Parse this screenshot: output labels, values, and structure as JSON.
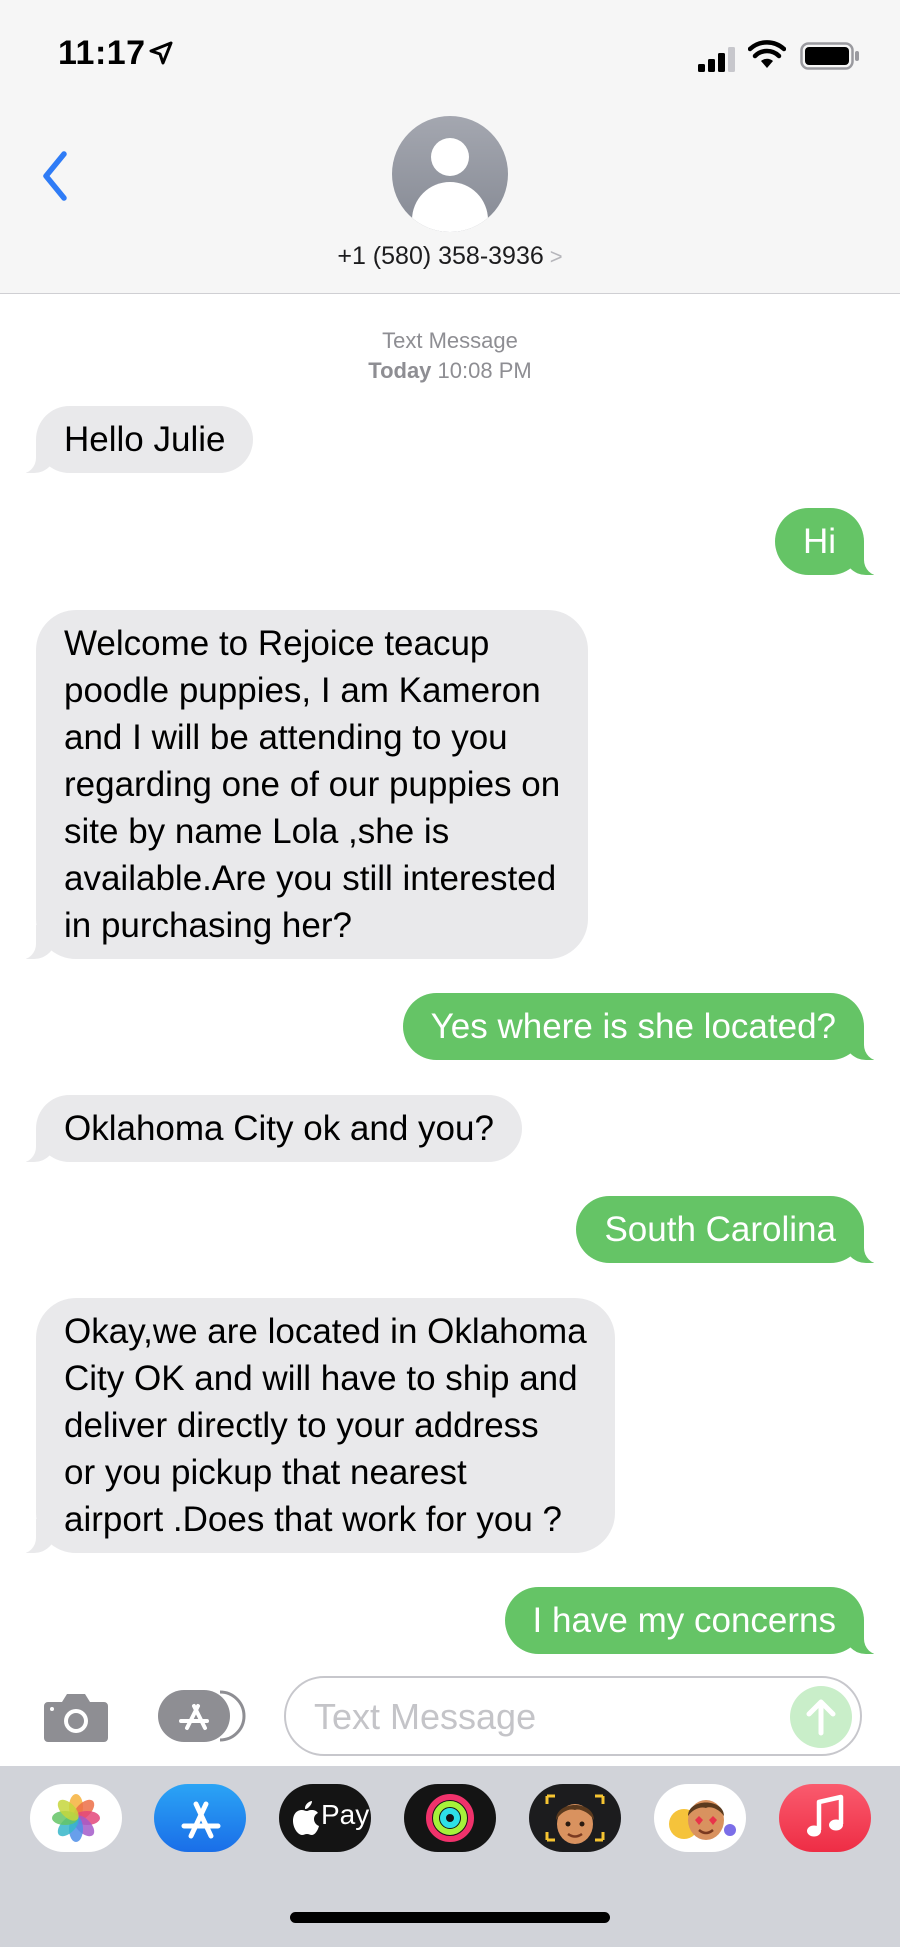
{
  "status_bar": {
    "time": "11:17",
    "icons": [
      "location-arrow-icon",
      "cellular-signal-icon",
      "wifi-icon",
      "battery-icon"
    ]
  },
  "header": {
    "back_icon": "chevron-left-icon",
    "contact": "+1 (580) 358-3936",
    "contact_chevron": ">"
  },
  "thread": {
    "service": "Text Message",
    "day": "Today",
    "time": "10:08 PM"
  },
  "messages": [
    {
      "direction": "incoming",
      "text": "Hello Julie"
    },
    {
      "direction": "outgoing",
      "text": "Hi"
    },
    {
      "direction": "incoming",
      "text": "Welcome to Rejoice teacup\npoodle puppies, I am Kameron\nand I will be attending to you\nregarding one of our puppies on\nsite by name Lola ,she is\navailable.Are you still interested\nin purchasing her?"
    },
    {
      "direction": "outgoing",
      "text": "Yes  where is she located?"
    },
    {
      "direction": "incoming",
      "text": "Oklahoma City ok and you?"
    },
    {
      "direction": "outgoing",
      "text": "South Carolina"
    },
    {
      "direction": "incoming",
      "text": "Okay,we are located in Oklahoma\nCity OK and will have to ship and\ndeliver directly to your address\nor you pickup that nearest\nairport .Does that work for you ?"
    },
    {
      "direction": "outgoing",
      "text": "I have my concerns"
    }
  ],
  "compose": {
    "placeholder": "Text Message",
    "icons": [
      "camera-icon",
      "app-store-icon",
      "send-arrow-icon"
    ]
  },
  "app_drawer": {
    "apps": [
      "Photos",
      "App Store",
      "Apple Pay",
      "Activity",
      "Memoji",
      "Animoji Stickers",
      "Music"
    ],
    "apple_pay_label": "Pay"
  },
  "colors": {
    "incoming_bubble": "#e9e9eb",
    "outgoing_bubble": "#65c466",
    "accent": "#2f7cf6"
  }
}
